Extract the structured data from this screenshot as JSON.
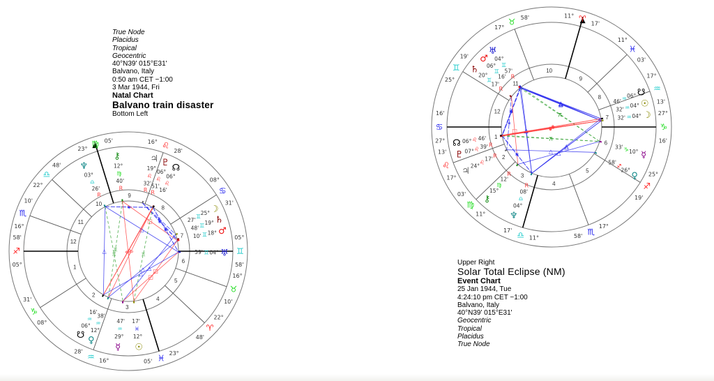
{
  "colors": {
    "fire": "#ff2020",
    "earth": "#22dd22",
    "air": "#22cccc",
    "water": "#2020ee",
    "aspect_hard": "#ff4040",
    "aspect_soft": "#3030ee",
    "aspect_minor": "#30a030",
    "text": "#333333"
  },
  "left_info": {
    "lines": [
      {
        "text": "True Node",
        "style": "it"
      },
      {
        "text": "Placidus",
        "style": "it"
      },
      {
        "text": "Tropical",
        "style": "it"
      },
      {
        "text": "Geocentric",
        "style": "it"
      },
      {
        "text": "40°N39' 015°E31'",
        "style": ""
      },
      {
        "text": "Balvano, Italy",
        "style": ""
      },
      {
        "text": "0:50 am  CET −1:00",
        "style": ""
      },
      {
        "text": "3 Mar 1944, Fri",
        "style": ""
      },
      {
        "text": "Natal Chart",
        "style": "bold"
      },
      {
        "text": "Balvano train disaster",
        "style": "big"
      },
      {
        "text": "Bottom Left",
        "style": ""
      }
    ]
  },
  "right_info": {
    "lines": [
      {
        "text": "Upper Right",
        "style": ""
      },
      {
        "text": "Solar Total Eclipse (NM)",
        "style": "big"
      },
      {
        "text": "Event Chart",
        "style": "bold"
      },
      {
        "text": "25 Jan 1944, Tue",
        "style": ""
      },
      {
        "text": "4:24:10 pm  CET −1:00",
        "style": ""
      },
      {
        "text": "Balvano, Italy",
        "style": ""
      },
      {
        "text": "40°N39' 015°E31'",
        "style": ""
      },
      {
        "text": "Geocentric",
        "style": "it"
      },
      {
        "text": "Tropical",
        "style": "it"
      },
      {
        "text": "Placidus",
        "style": "it"
      },
      {
        "text": "True Node",
        "style": "it"
      }
    ]
  },
  "charts": [
    {
      "name": "balvano-natal",
      "asc": {
        "sign": "sagittarius",
        "deg": 5,
        "min": 58
      },
      "cusps": [
        {
          "house": 1,
          "sign": "sagittarius",
          "deg": 5,
          "min": 58
        },
        {
          "house": 2,
          "sign": "capricorn",
          "deg": 8,
          "min": 31
        },
        {
          "house": 3,
          "sign": "aquarius",
          "deg": 16,
          "min": 28
        },
        {
          "house": 4,
          "sign": "pisces",
          "deg": 23,
          "min": 5
        },
        {
          "house": 5,
          "sign": "aries",
          "deg": 22,
          "min": 48
        },
        {
          "house": 6,
          "sign": "taurus",
          "deg": 16,
          "min": 10
        },
        {
          "house": 7,
          "sign": "gemini",
          "deg": 5,
          "min": 58
        },
        {
          "house": 8,
          "sign": "cancer",
          "deg": 8,
          "min": 31
        },
        {
          "house": 9,
          "sign": "leo",
          "deg": 16,
          "min": 28
        },
        {
          "house": 10,
          "sign": "virgo",
          "deg": 23,
          "min": 5
        },
        {
          "house": 11,
          "sign": "libra",
          "deg": 22,
          "min": 48
        },
        {
          "house": 12,
          "sign": "scorpio",
          "deg": 16,
          "min": 10
        }
      ],
      "planets": [
        {
          "name": "neptune",
          "glyph": "♆",
          "color": "#118888",
          "sign": "libra",
          "deg": "03°",
          "min": "26'",
          "retro": true
        },
        {
          "name": "chiron",
          "glyph": "⚷",
          "color": "#118811",
          "sign": "virgo",
          "deg": "12°",
          "min": "40'",
          "retro": true
        },
        {
          "name": "jupiter",
          "glyph": "♃",
          "color": "#666666",
          "sign": "leo",
          "deg": "19°",
          "min": "32'",
          "retro": true
        },
        {
          "name": "pluto",
          "glyph": "♇",
          "color": "#880000",
          "sign": "leo",
          "deg": "06°",
          "min": "51'",
          "retro": true
        },
        {
          "name": "north-node",
          "glyph": "☊",
          "color": "#000000",
          "sign": "leo",
          "deg": "06°",
          "min": "16'",
          "retro": false
        },
        {
          "name": "moon",
          "glyph": "☽",
          "color": "#888800",
          "sign": "gemini",
          "deg": "25°",
          "min": "27'",
          "retro": false
        },
        {
          "name": "saturn",
          "glyph": "♄",
          "color": "#880000",
          "sign": "gemini",
          "deg": "19°",
          "min": "48'",
          "retro": false
        },
        {
          "name": "mars",
          "glyph": "♂",
          "color": "#ee1111",
          "sign": "gemini",
          "deg": "18°",
          "min": "10'",
          "retro": false
        },
        {
          "name": "uranus",
          "glyph": "♅",
          "color": "#1111cc",
          "sign": "gemini",
          "deg": "04°",
          "min": "59'",
          "retro": false
        },
        {
          "name": "south-node",
          "glyph": "☋",
          "color": "#000000",
          "sign": "aquarius",
          "deg": "06°",
          "min": "16'",
          "retro": false
        },
        {
          "name": "venus",
          "glyph": "♀",
          "color": "#118888",
          "sign": "aquarius",
          "deg": "12°",
          "min": "38'",
          "retro": false
        },
        {
          "name": "mercury",
          "glyph": "☿",
          "color": "#880088",
          "sign": "aquarius",
          "deg": "29°",
          "min": "47'",
          "retro": false
        },
        {
          "name": "sun",
          "glyph": "☉",
          "color": "#888800",
          "sign": "pisces",
          "deg": "12°",
          "min": "17'",
          "retro": false
        }
      ]
    },
    {
      "name": "solar-eclipse",
      "asc": {
        "sign": "cancer",
        "deg": 27,
        "min": 16
      },
      "cusps": [
        {
          "house": 1,
          "sign": "cancer",
          "deg": 27,
          "min": 16
        },
        {
          "house": 2,
          "sign": "leo",
          "deg": 17,
          "min": 13
        },
        {
          "house": 3,
          "sign": "virgo",
          "deg": 11,
          "min": 3
        },
        {
          "house": 4,
          "sign": "libra",
          "deg": 11,
          "min": 17
        },
        {
          "house": 5,
          "sign": "scorpio",
          "deg": 17,
          "min": 58
        },
        {
          "house": 6,
          "sign": "sagittarius",
          "deg": 25,
          "min": 19
        },
        {
          "house": 7,
          "sign": "capricorn",
          "deg": 27,
          "min": 16
        },
        {
          "house": 8,
          "sign": "aquarius",
          "deg": 17,
          "min": 13
        },
        {
          "house": 9,
          "sign": "pisces",
          "deg": 11,
          "min": 3
        },
        {
          "house": 10,
          "sign": "aries",
          "deg": 11,
          "min": 17
        },
        {
          "house": 11,
          "sign": "taurus",
          "deg": 17,
          "min": 58
        },
        {
          "house": 12,
          "sign": "gemini",
          "deg": 25,
          "min": 19
        }
      ],
      "planets": [
        {
          "name": "uranus",
          "glyph": "♅",
          "color": "#1111cc",
          "sign": "gemini",
          "deg": "04°",
          "min": "57'",
          "retro": true
        },
        {
          "name": "mars",
          "glyph": "♂",
          "color": "#ee1111",
          "sign": "gemini",
          "deg": "06°",
          "min": "16'",
          "retro": false
        },
        {
          "name": "saturn",
          "glyph": "♄",
          "color": "#880000",
          "sign": "gemini",
          "deg": "20°",
          "min": "17'",
          "retro": true
        },
        {
          "name": "north-node",
          "glyph": "☊",
          "color": "#000000",
          "sign": "leo",
          "deg": "06°",
          "min": "46'",
          "retro": false
        },
        {
          "name": "pluto",
          "glyph": "♇",
          "color": "#880000",
          "sign": "leo",
          "deg": "07°",
          "min": "39'",
          "retro": true
        },
        {
          "name": "jupiter",
          "glyph": "♃",
          "color": "#666666",
          "sign": "leo",
          "deg": "24°",
          "min": "17'",
          "retro": true
        },
        {
          "name": "chiron",
          "glyph": "⚷",
          "color": "#118811",
          "sign": "virgo",
          "deg": "15°",
          "min": "12'",
          "retro": true
        },
        {
          "name": "neptune",
          "glyph": "♆",
          "color": "#118888",
          "sign": "libra",
          "deg": "04°",
          "min": "08'",
          "retro": true
        },
        {
          "name": "venus",
          "glyph": "♀",
          "color": "#118888",
          "sign": "sagittarius",
          "deg": "26°",
          "min": "58'",
          "retro": false
        },
        {
          "name": "mercury",
          "glyph": "☿",
          "color": "#880088",
          "sign": "capricorn",
          "deg": "10°",
          "min": "33'",
          "retro": false
        },
        {
          "name": "moon",
          "glyph": "☽",
          "color": "#888800",
          "sign": "aquarius",
          "deg": "04°",
          "min": "32'",
          "retro": false
        },
        {
          "name": "sun",
          "glyph": "☉",
          "color": "#888800",
          "sign": "aquarius",
          "deg": "04°",
          "min": "32'",
          "retro": false
        },
        {
          "name": "south-node",
          "glyph": "☋",
          "color": "#000000",
          "sign": "aquarius",
          "deg": "06°",
          "min": "46'",
          "retro": false
        }
      ]
    }
  ],
  "signs": {
    "aries": {
      "glyph": "♈",
      "color": "#ff2020"
    },
    "taurus": {
      "glyph": "♉",
      "color": "#22dd22"
    },
    "gemini": {
      "glyph": "♊",
      "color": "#22cccc"
    },
    "cancer": {
      "glyph": "♋",
      "color": "#2020ee"
    },
    "leo": {
      "glyph": "♌",
      "color": "#ff2020"
    },
    "virgo": {
      "glyph": "♍",
      "color": "#22dd22"
    },
    "libra": {
      "glyph": "♎",
      "color": "#22cccc"
    },
    "scorpio": {
      "glyph": "♏",
      "color": "#2020ee"
    },
    "sagittarius": {
      "glyph": "♐",
      "color": "#ff2020"
    },
    "capricorn": {
      "glyph": "♑",
      "color": "#22dd22"
    },
    "aquarius": {
      "glyph": "♒",
      "color": "#22cccc"
    },
    "pisces": {
      "glyph": "♓",
      "color": "#2020ee"
    }
  },
  "retro_symbol": "R"
}
